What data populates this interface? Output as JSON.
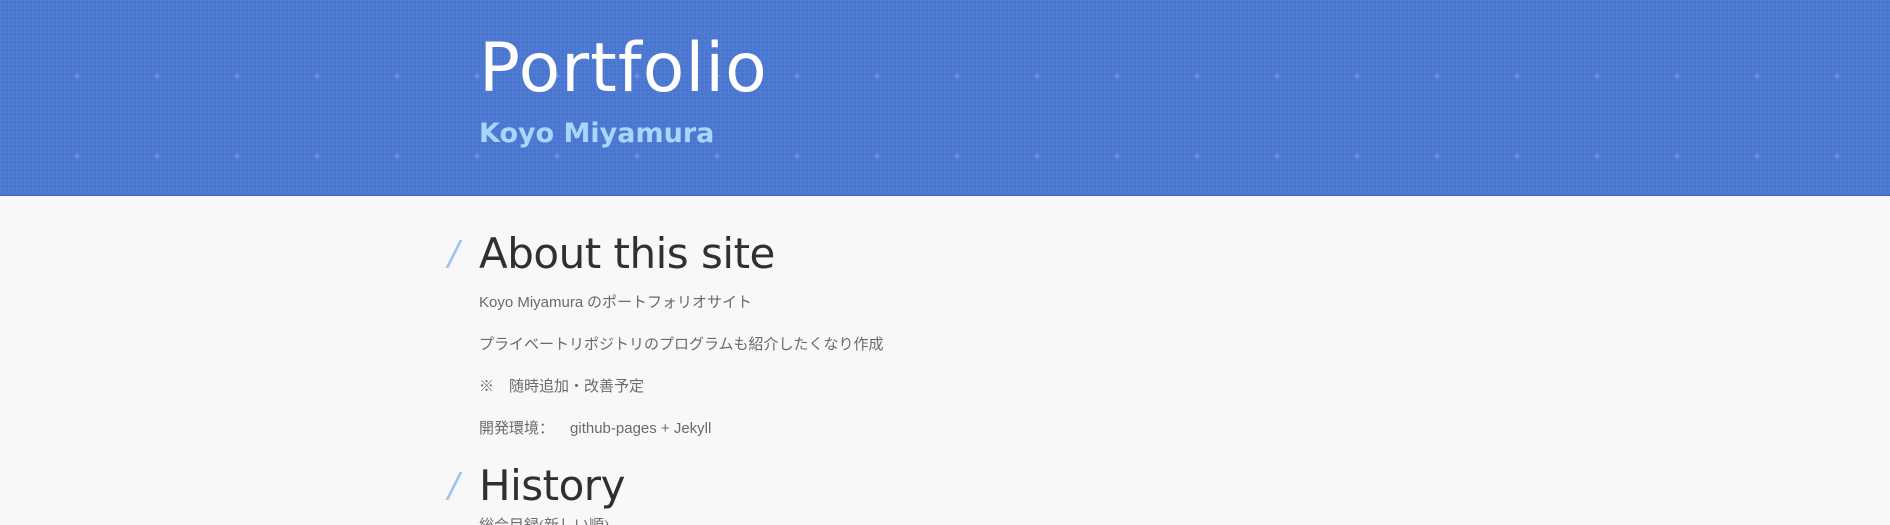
{
  "header": {
    "title": "Portfolio",
    "subtitle": "Koyo Miyamura"
  },
  "colors": {
    "header_bg": "#4a76d0",
    "title": "#ffffff",
    "subtitle": "#a9d6ff",
    "heading": "#303030",
    "slash_accent": "#9cc6f2",
    "body_text": "#6a6a6a",
    "page_bg": "#f8f8f8"
  },
  "sections": [
    {
      "icon": "slash-icon",
      "heading": "About this site",
      "paragraphs": [
        {
          "name_part": "Koyo Miyamura",
          "rest": " のポートフォリオサイト"
        },
        {
          "text": "プライベートリポジトリのプログラムも紹介したくなり作成"
        },
        {
          "text": "※　随時追加・改善予定"
        },
        {
          "label": "開発環境：",
          "value": "github-pages + Jekyll"
        }
      ]
    },
    {
      "icon": "slash-icon",
      "heading": "History",
      "partial_text": "総合目録(新しい順)"
    }
  ]
}
